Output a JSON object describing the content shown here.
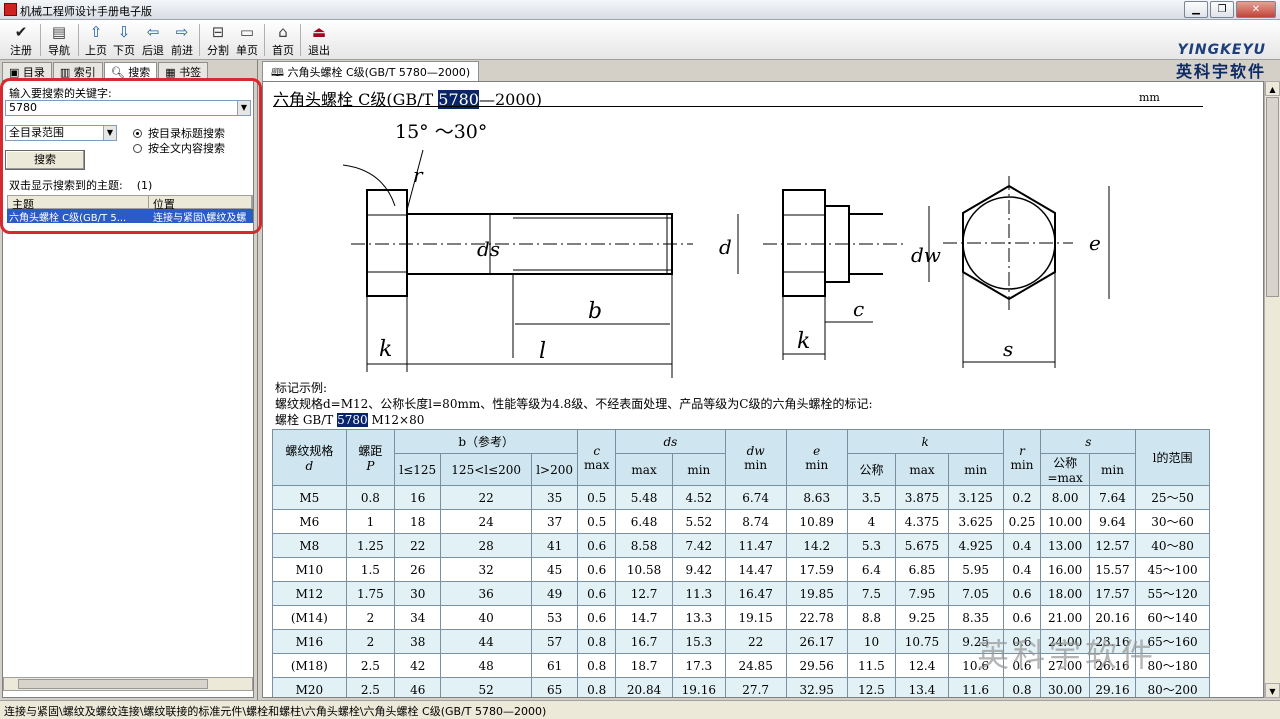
{
  "window": {
    "title": "机械工程师设计手册电子版"
  },
  "toolbar": {
    "items": [
      {
        "label": "注册",
        "icon": "check-icon"
      },
      {
        "label": "导航",
        "icon": "navigate-icon"
      },
      {
        "label": "上页",
        "icon": "arrow-up-icon"
      },
      {
        "label": "下页",
        "icon": "arrow-down-icon"
      },
      {
        "label": "后退",
        "icon": "arrow-left-icon"
      },
      {
        "label": "前进",
        "icon": "arrow-right-icon"
      },
      {
        "label": "分割",
        "icon": "split-icon"
      },
      {
        "label": "单页",
        "icon": "single-page-icon"
      },
      {
        "label": "首页",
        "icon": "home-icon"
      },
      {
        "label": "退出",
        "icon": "exit-icon"
      }
    ]
  },
  "logo": {
    "en": "YINGKEYU",
    "cn": "英科宇软件"
  },
  "left_tabs": [
    "目录",
    "索引",
    "搜索",
    "书签"
  ],
  "search": {
    "keyword_label": "输入要搜索的关键字:",
    "keyword_value": "5780",
    "scope_value": "全目录范围",
    "option_title": "按目录标题搜索",
    "option_fulltext": "按全文内容搜索",
    "search_button": "搜索",
    "results_label": "双击显示搜索到的主题:",
    "results_count": "(1)",
    "col_topic": "主题",
    "col_location": "位置",
    "result_topic": "六角头螺栓 C级(GB/T 5...",
    "result_location": "连接与紧固\\螺纹及螺"
  },
  "doc_tab": "六角头螺栓 C级(GB/T 5780—2000)",
  "doc": {
    "title_pre": "六角头螺栓  C级(GB/T ",
    "title_hl": "5780",
    "title_post": "—2000)",
    "unit": "mm",
    "angle_label": "15° ～30°",
    "example_title": "标记示例:",
    "example_line1": "螺纹规格d=M12、公称长度l=80mm、性能等级为4.8级、不经表面处理、产品等级为C级的六角头螺栓的标记:",
    "example_line2_pre": "螺栓  GB/T ",
    "example_line2_hl": "5780",
    "example_line2_post": "  M12×80"
  },
  "table": {
    "h_d": "螺纹规格",
    "h_d_sym": "d",
    "h_p": "螺距",
    "h_p_sym": "P",
    "h_b": "b（参考）",
    "h_b1": "l≤125",
    "h_b2": "125<l≤200",
    "h_b3": "l>200",
    "h_c": "c",
    "h_c_sub": "max",
    "h_ds": "ds",
    "h_max": "max",
    "h_min": "min",
    "h_dw": "dw",
    "h_dw_sub": "min",
    "h_e": "e",
    "h_e_sub": "min",
    "h_k": "k",
    "h_k_nom": "公称",
    "h_r": "r",
    "h_r_sub": "min",
    "h_s": "s",
    "h_s_nom": "公称=max",
    "h_l": "l的范围",
    "rows": [
      [
        "M5",
        "0.8",
        "16",
        "22",
        "35",
        "0.5",
        "5.48",
        "4.52",
        "6.74",
        "8.63",
        "3.5",
        "3.875",
        "3.125",
        "0.2",
        "8.00",
        "7.64",
        "25～50"
      ],
      [
        "M6",
        "1",
        "18",
        "24",
        "37",
        "0.5",
        "6.48",
        "5.52",
        "8.74",
        "10.89",
        "4",
        "4.375",
        "3.625",
        "0.25",
        "10.00",
        "9.64",
        "30～60"
      ],
      [
        "M8",
        "1.25",
        "22",
        "28",
        "41",
        "0.6",
        "8.58",
        "7.42",
        "11.47",
        "14.2",
        "5.3",
        "5.675",
        "4.925",
        "0.4",
        "13.00",
        "12.57",
        "40～80"
      ],
      [
        "M10",
        "1.5",
        "26",
        "32",
        "45",
        "0.6",
        "10.58",
        "9.42",
        "14.47",
        "17.59",
        "6.4",
        "6.85",
        "5.95",
        "0.4",
        "16.00",
        "15.57",
        "45～100"
      ],
      [
        "M12",
        "1.75",
        "30",
        "36",
        "49",
        "0.6",
        "12.7",
        "11.3",
        "16.47",
        "19.85",
        "7.5",
        "7.95",
        "7.05",
        "0.6",
        "18.00",
        "17.57",
        "55～120"
      ],
      [
        "(M14)",
        "2",
        "34",
        "40",
        "53",
        "0.6",
        "14.7",
        "13.3",
        "19.15",
        "22.78",
        "8.8",
        "9.25",
        "8.35",
        "0.6",
        "21.00",
        "20.16",
        "60～140"
      ],
      [
        "M16",
        "2",
        "38",
        "44",
        "57",
        "0.8",
        "16.7",
        "15.3",
        "22",
        "26.17",
        "10",
        "10.75",
        "9.25",
        "0.6",
        "24.00",
        "23.16",
        "65～160"
      ],
      [
        "(M18)",
        "2.5",
        "42",
        "48",
        "61",
        "0.8",
        "18.7",
        "17.3",
        "24.85",
        "29.56",
        "11.5",
        "12.4",
        "10.6",
        "0.6",
        "27.00",
        "26.16",
        "80～180"
      ],
      [
        "M20",
        "2.5",
        "46",
        "52",
        "65",
        "0.8",
        "20.84",
        "19.16",
        "27.7",
        "32.95",
        "12.5",
        "13.4",
        "11.6",
        "0.8",
        "30.00",
        "29.16",
        "80～200"
      ]
    ]
  },
  "status": "连接与紧固\\螺纹及螺纹连接\\螺纹联接的标准元件\\螺栓和螺柱\\六角头螺栓\\六角头螺栓 C级(GB/T 5780—2000)",
  "watermark": "英科宇软件"
}
